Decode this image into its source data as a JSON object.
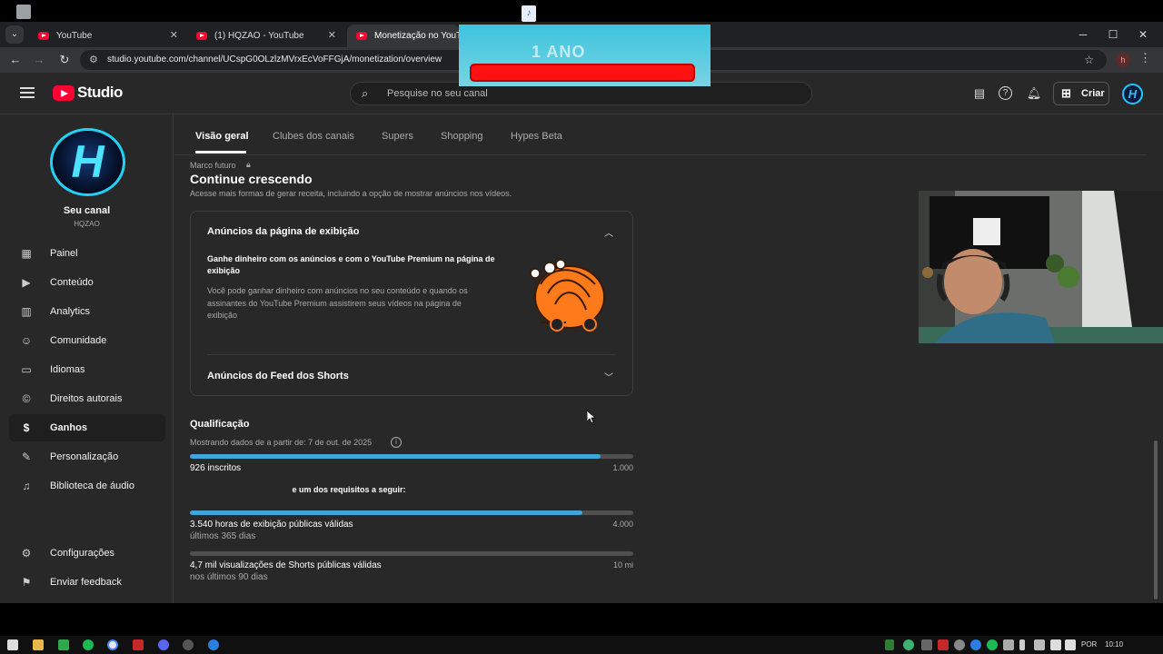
{
  "browser": {
    "tabs": [
      {
        "title": "YouTube"
      },
      {
        "title": "(1) HQZAO - YouTube"
      },
      {
        "title": "Monetização no YouTube"
      }
    ],
    "url": "studio.youtube.com/channel/UCspG0OLzlzMVrxEcVoFFGjA/monetization/overview",
    "profile_initial": "h"
  },
  "overlay_banner": {
    "text": "1 ANO"
  },
  "studio": {
    "logo_text": "Studio",
    "search_placeholder": "Pesquise no seu canal",
    "create_label": "Criar",
    "avatar_initial": "H"
  },
  "sidebar": {
    "channel_title": "Seu canal",
    "channel_handle": "HQZAO",
    "items": [
      {
        "label": "Painel",
        "icon": "dashboard-icon"
      },
      {
        "label": "Conteúdo",
        "icon": "content-icon"
      },
      {
        "label": "Analytics",
        "icon": "analytics-icon"
      },
      {
        "label": "Comunidade",
        "icon": "community-icon"
      },
      {
        "label": "Idiomas",
        "icon": "subtitles-icon"
      },
      {
        "label": "Direitos autorais",
        "icon": "copyright-icon"
      },
      {
        "label": "Ganhos",
        "icon": "dollar-icon"
      },
      {
        "label": "Personalização",
        "icon": "magic-wand-icon"
      },
      {
        "label": "Biblioteca de áudio",
        "icon": "audio-library-icon"
      }
    ],
    "footer": [
      {
        "label": "Configurações",
        "icon": "gear-icon"
      },
      {
        "label": "Enviar feedback",
        "icon": "feedback-icon"
      }
    ]
  },
  "main": {
    "tabs": [
      "Visão geral",
      "Clubes dos canais",
      "Supers",
      "Shopping",
      "Hypes Beta"
    ],
    "milestone_label": "Marco futuro",
    "section_title": "Continue crescendo",
    "section_subtitle": "Acesse mais formas de gerar receita, incluindo a opção de mostrar anúncios nos vídeos.",
    "card": {
      "header1": "Anúncios da página de exibição",
      "bold_text": "Ganhe dinheiro com os anúncios e com o YouTube Premium na página de exibição",
      "description": "Você pode ganhar dinheiro com anúncios no seu conteúdo e quando os assinantes do YouTube Premium assistirem seus vídeos na página de exibição",
      "header2": "Anúncios do Feed dos Shorts"
    },
    "qualification": {
      "title": "Qualificação",
      "date_text": "Mostrando dados de a partir de: 7 de out. de 2025",
      "subscribers": {
        "label": "926 inscritos",
        "target": "1.000",
        "progress": 0.926
      },
      "requirement_text": "e um dos requisitos a seguir:",
      "watch_hours": {
        "label": "3.540 horas de exibição públicas válidas",
        "sub": "últimos 365 dias",
        "target": "4.000",
        "progress": 0.885
      },
      "shorts_views": {
        "label": "4,7 mil visualizações de Shorts públicas válidas",
        "sub": "nos últimos 90 dias",
        "target": "10 mi",
        "progress": 0.0
      }
    }
  },
  "taskbar": {
    "lang": "POR",
    "time": "10:10"
  },
  "colors": {
    "accent_progress": "#3ea6d8",
    "youtube_red": "#ff0033",
    "studio_bg": "#282828"
  }
}
